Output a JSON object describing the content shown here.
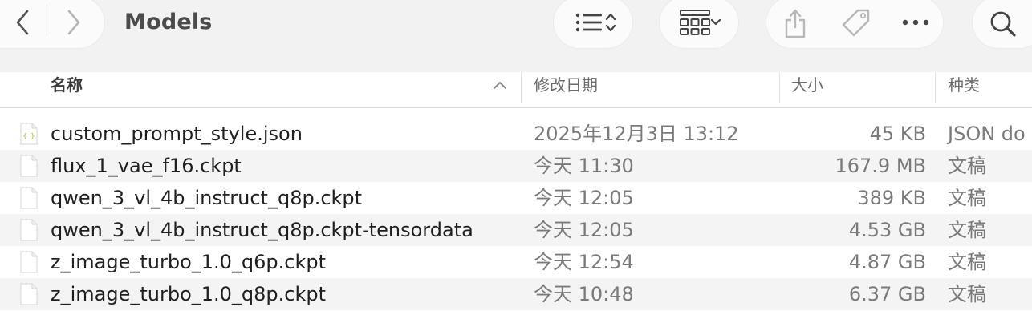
{
  "window": {
    "title": "Models"
  },
  "toolbar": {
    "icons": [
      "chevron-left-icon",
      "chevron-right-icon",
      "list-view-icon",
      "sort-updown-icon",
      "grid-view-icon",
      "chevron-down-icon",
      "share-icon",
      "tag-icon",
      "more-icon",
      "search-icon"
    ]
  },
  "columns": {
    "name": "名称",
    "date": "修改日期",
    "size": "大小",
    "kind": "种类"
  },
  "files": [
    {
      "name": "custom_prompt_style.json",
      "date": "2025年12月3日 13:12",
      "size": "45 KB",
      "kind": "JSON do",
      "icon": "json-file-icon"
    },
    {
      "name": "flux_1_vae_f16.ckpt",
      "date": "今天 11:30",
      "size": "167.9 MB",
      "kind": "文稿",
      "icon": "document-icon"
    },
    {
      "name": "qwen_3_vl_4b_instruct_q8p.ckpt",
      "date": "今天 12:05",
      "size": "389 KB",
      "kind": "文稿",
      "icon": "document-icon"
    },
    {
      "name": "qwen_3_vl_4b_instruct_q8p.ckpt-tensordata",
      "date": "今天 12:05",
      "size": "4.53 GB",
      "kind": "文稿",
      "icon": "document-icon"
    },
    {
      "name": "z_image_turbo_1.0_q6p.ckpt",
      "date": "今天 12:54",
      "size": "4.87 GB",
      "kind": "文稿",
      "icon": "document-icon"
    },
    {
      "name": "z_image_turbo_1.0_q8p.ckpt",
      "date": "今天 10:48",
      "size": "6.37 GB",
      "kind": "文稿",
      "icon": "document-icon"
    }
  ]
}
